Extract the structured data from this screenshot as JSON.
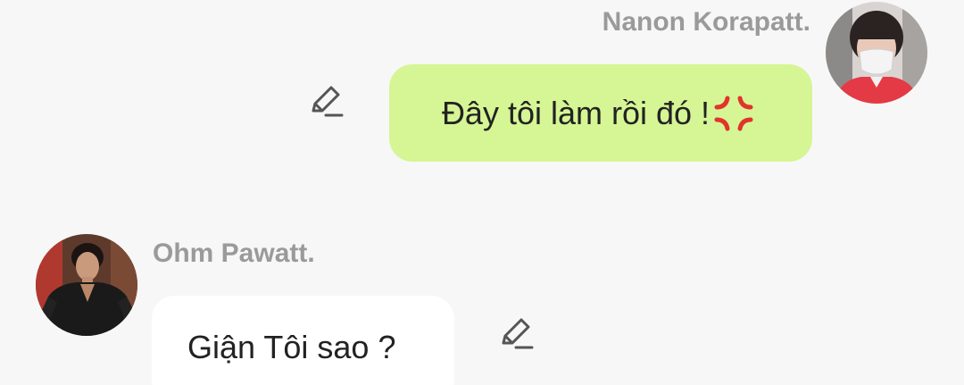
{
  "messages": [
    {
      "sender": "Nanon Korapatt.",
      "side": "right",
      "text": "Đây tôi làm rồi đó !",
      "trailing_emoji": "anger-symbol",
      "bubble_color": "#d6f594"
    },
    {
      "sender": "Ohm Pawatt.",
      "side": "left",
      "text": "Giận Tôi sao ?",
      "bubble_color": "#ffffff"
    }
  ],
  "colors": {
    "background": "#f7f7f7",
    "sender_name": "#9a9a9a",
    "anger_emoji": "#e2332c",
    "edit_icon": "#555555"
  },
  "icons": {
    "edit": "pencil-edit-icon"
  }
}
